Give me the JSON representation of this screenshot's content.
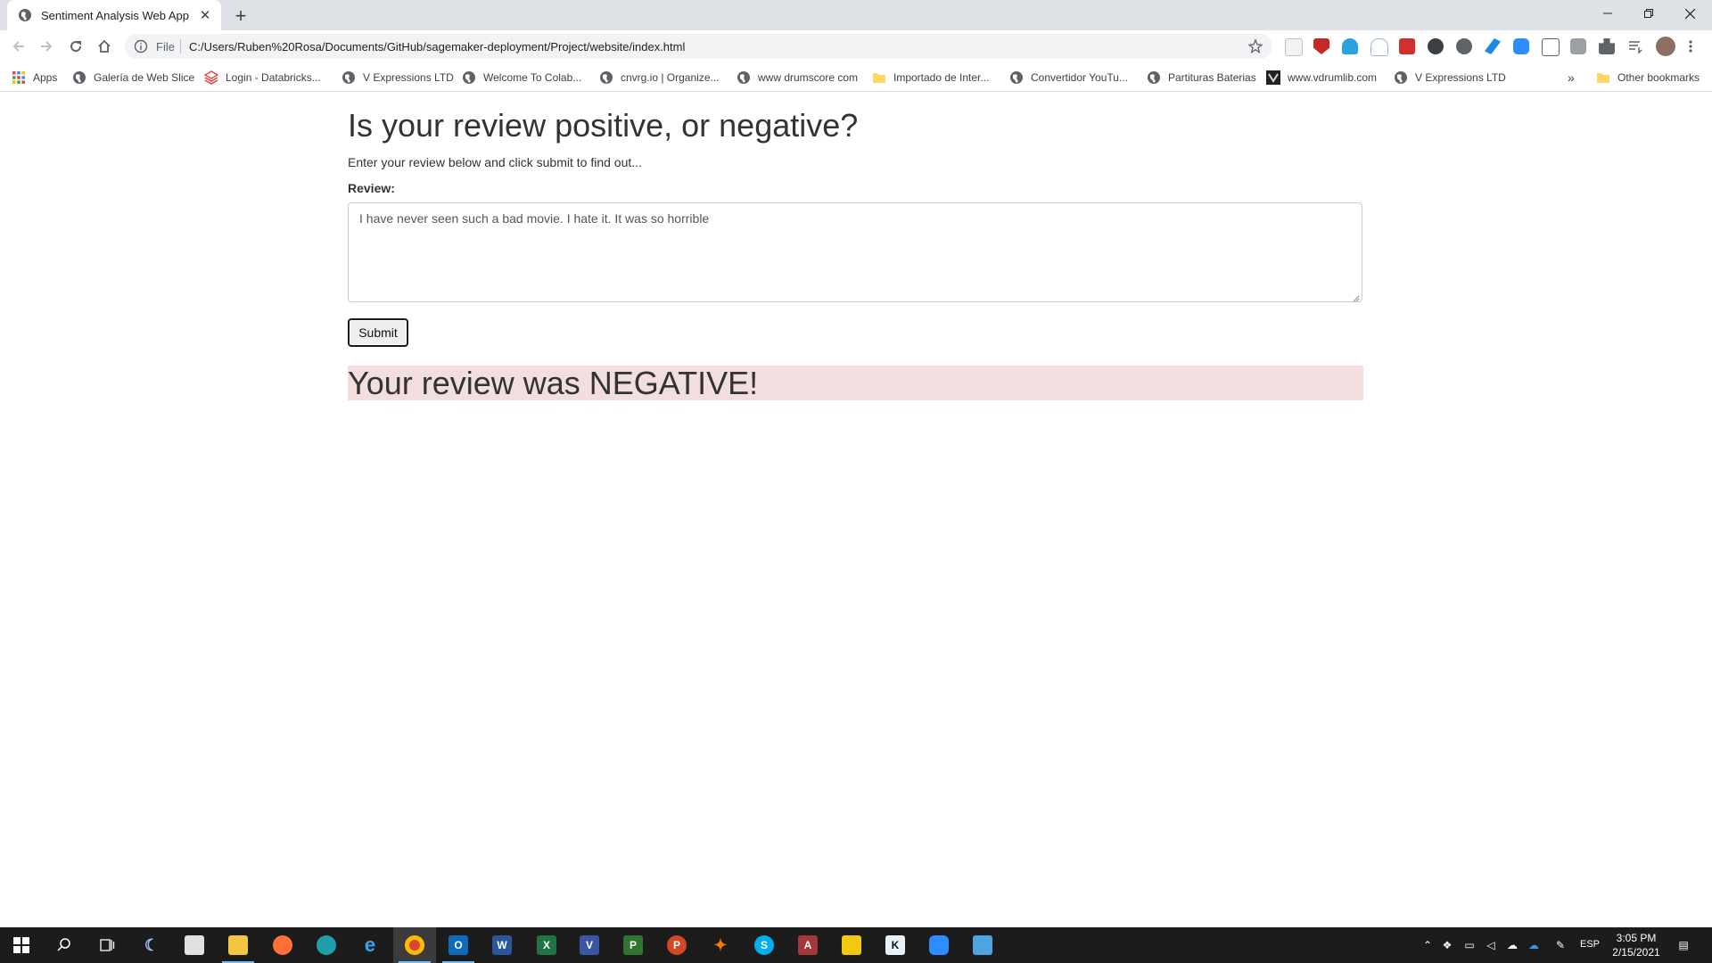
{
  "browser": {
    "tab_title": "Sentiment Analysis Web App",
    "scheme_label": "File",
    "url": "C:/Users/Ruben%20Rosa/Documents/GitHub/sagemaker-deployment/Project/website/index.html"
  },
  "bookmarks": {
    "apps_label": "Apps",
    "items": [
      {
        "label": "Galería de Web Slice",
        "icon": "globe-icon"
      },
      {
        "label": "Login - Databricks...",
        "icon": "databricks-icon"
      },
      {
        "label": "V Expressions LTD",
        "icon": "globe-icon"
      },
      {
        "label": "Welcome To Colab...",
        "icon": "globe-icon"
      },
      {
        "label": "cnvrg.io | Organize...",
        "icon": "globe-icon"
      },
      {
        "label": "www drumscore com",
        "icon": "globe-icon"
      },
      {
        "label": "Importado de Inter...",
        "icon": "folder-icon"
      },
      {
        "label": "Convertidor YouTu...",
        "icon": "globe-icon"
      },
      {
        "label": "Partituras Baterias",
        "icon": "globe-icon"
      },
      {
        "label": "www.vdrumlib.com",
        "icon": "vdrumlib-icon"
      },
      {
        "label": "V Expressions LTD",
        "icon": "globe-icon"
      }
    ],
    "more_label": "»",
    "other_label": "Other bookmarks"
  },
  "page": {
    "heading": "Is your review positive, or negative?",
    "lead": "Enter your review below and click submit to find out...",
    "review_label": "Review:",
    "review_text": "I have never seen such a bad movie. I hate it. It was so horrible",
    "submit_label": "Submit",
    "result_text": "Your review was NEGATIVE!",
    "result_bg_color": "#f2dede"
  },
  "taskbar": {
    "language": "ESP",
    "time": "3:05 PM",
    "date": "2/15/2021"
  }
}
